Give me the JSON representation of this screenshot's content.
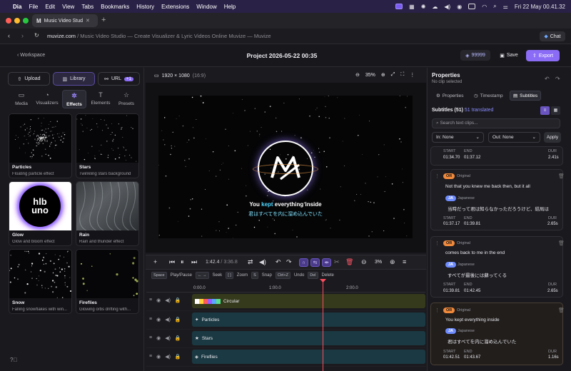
{
  "menubar": {
    "app": "Dia",
    "items": [
      "File",
      "Edit",
      "View",
      "Tabs",
      "Bookmarks",
      "History",
      "Extensions",
      "Window",
      "Help"
    ],
    "clock": "Fri 22 May  00.41.32"
  },
  "browser": {
    "tab_title": "Music Video Stud",
    "url_host": "muvize.com",
    "url_rest": " / Music Video Studio — Create Visualizer & Lyric Videos Online Muvize — Muvize",
    "chat_label": "Chat"
  },
  "header": {
    "back_label": "Workspace",
    "project_title": "Project 2026-05-22 00:35",
    "credits": "99999",
    "save_label": "Save",
    "export_label": "Export"
  },
  "left": {
    "sources": [
      {
        "label": "Upload",
        "icon": "upload-icon"
      },
      {
        "label": "Library",
        "icon": "library-icon"
      },
      {
        "label": "URL",
        "icon": "link-icon",
        "badge": "+1"
      }
    ],
    "categories": [
      {
        "label": "Media",
        "icon": "folder-icon"
      },
      {
        "label": "Visualizers",
        "icon": "visualizer-icon"
      },
      {
        "label": "Effects",
        "icon": "effects-icon",
        "active": true
      },
      {
        "label": "Elements",
        "icon": "text-icon"
      },
      {
        "label": "Presets",
        "icon": "star-icon"
      }
    ],
    "effects": [
      {
        "title": "Particles",
        "desc": "Floating particle effect"
      },
      {
        "title": "Stars",
        "desc": "Twinkling stars background"
      },
      {
        "title": "Glow",
        "desc": "Glow and bloom effect",
        "thumb_text": "hlb uno"
      },
      {
        "title": "Rain",
        "desc": "Rain and thunder effect"
      },
      {
        "title": "Snow",
        "desc": "Falling snowflakes with win..."
      },
      {
        "title": "Fireflies",
        "desc": "Glowing orbs drifting with..."
      }
    ]
  },
  "preview": {
    "resolution": "1920 × 1080",
    "aspect": "(16:9)",
    "zoom": "35%",
    "lyric_before": "You ",
    "lyric_highlight": "kept",
    "lyric_after": " everything inside",
    "lyric_translation": "君はすべてを内に溜め込んでいた"
  },
  "controls": {
    "time_current": "1:42.4",
    "time_total": "3:36.8",
    "zoom": "3%",
    "shortcuts": [
      {
        "key": "Space",
        "label": "Play/Pause"
      },
      {
        "key": "← →",
        "label": "Seek"
      },
      {
        "key": "[ ]",
        "label": "Zoom"
      },
      {
        "key": "S",
        "label": "Snap"
      },
      {
        "key": "Ctrl+Z",
        "label": "Undo"
      },
      {
        "key": "Del",
        "label": "Delete"
      }
    ]
  },
  "timeline": {
    "ticks": [
      "0:00.0",
      "1:00.0",
      "2:00.0"
    ],
    "tracks": [
      {
        "name": "Circular",
        "color": "#3a3f1e"
      },
      {
        "name": "Particles",
        "color": "#1c3a44"
      },
      {
        "name": "Stars",
        "color": "#1c3a44"
      },
      {
        "name": "Fireflies",
        "color": "#1c3a44"
      }
    ]
  },
  "right": {
    "title": "Properties",
    "subtitle": "No clip selected",
    "tabs": [
      "Properties",
      "Timestamp",
      "Subtitles"
    ],
    "subs_label": "Subtitles (51)",
    "translated": "51 translated",
    "search_placeholder": "Search text clips...",
    "in_label": "In: None",
    "out_label": "Out: None",
    "apply_label": "Apply",
    "start_label": "START",
    "end_label": "END",
    "dur_label": "DUR",
    "original_label": "Original",
    "japanese_label": "Japanese",
    "or_badge": "OR",
    "ja_badge": "JA",
    "cards": [
      {
        "start": "01:34.70",
        "end": "01:37.12",
        "dur": "2.41s"
      },
      {
        "original": "Not that you knew me back then, but it all",
        "japanese": "当時だって君は知らなかっただろうけど、結局は",
        "start": "01:37.17",
        "end": "01:39.81",
        "dur": "2.65s"
      },
      {
        "original": "comes back to me in the end",
        "japanese": "すべてが最後には蘇ってくる",
        "start": "01:39.81",
        "end": "01:42.45",
        "dur": "2.65s"
      },
      {
        "original": "You kept everything inside",
        "japanese": "君はすべてを内に溜め込んでいた",
        "start": "01:42.51",
        "end": "01:43.67",
        "dur": "1.16s"
      }
    ]
  }
}
